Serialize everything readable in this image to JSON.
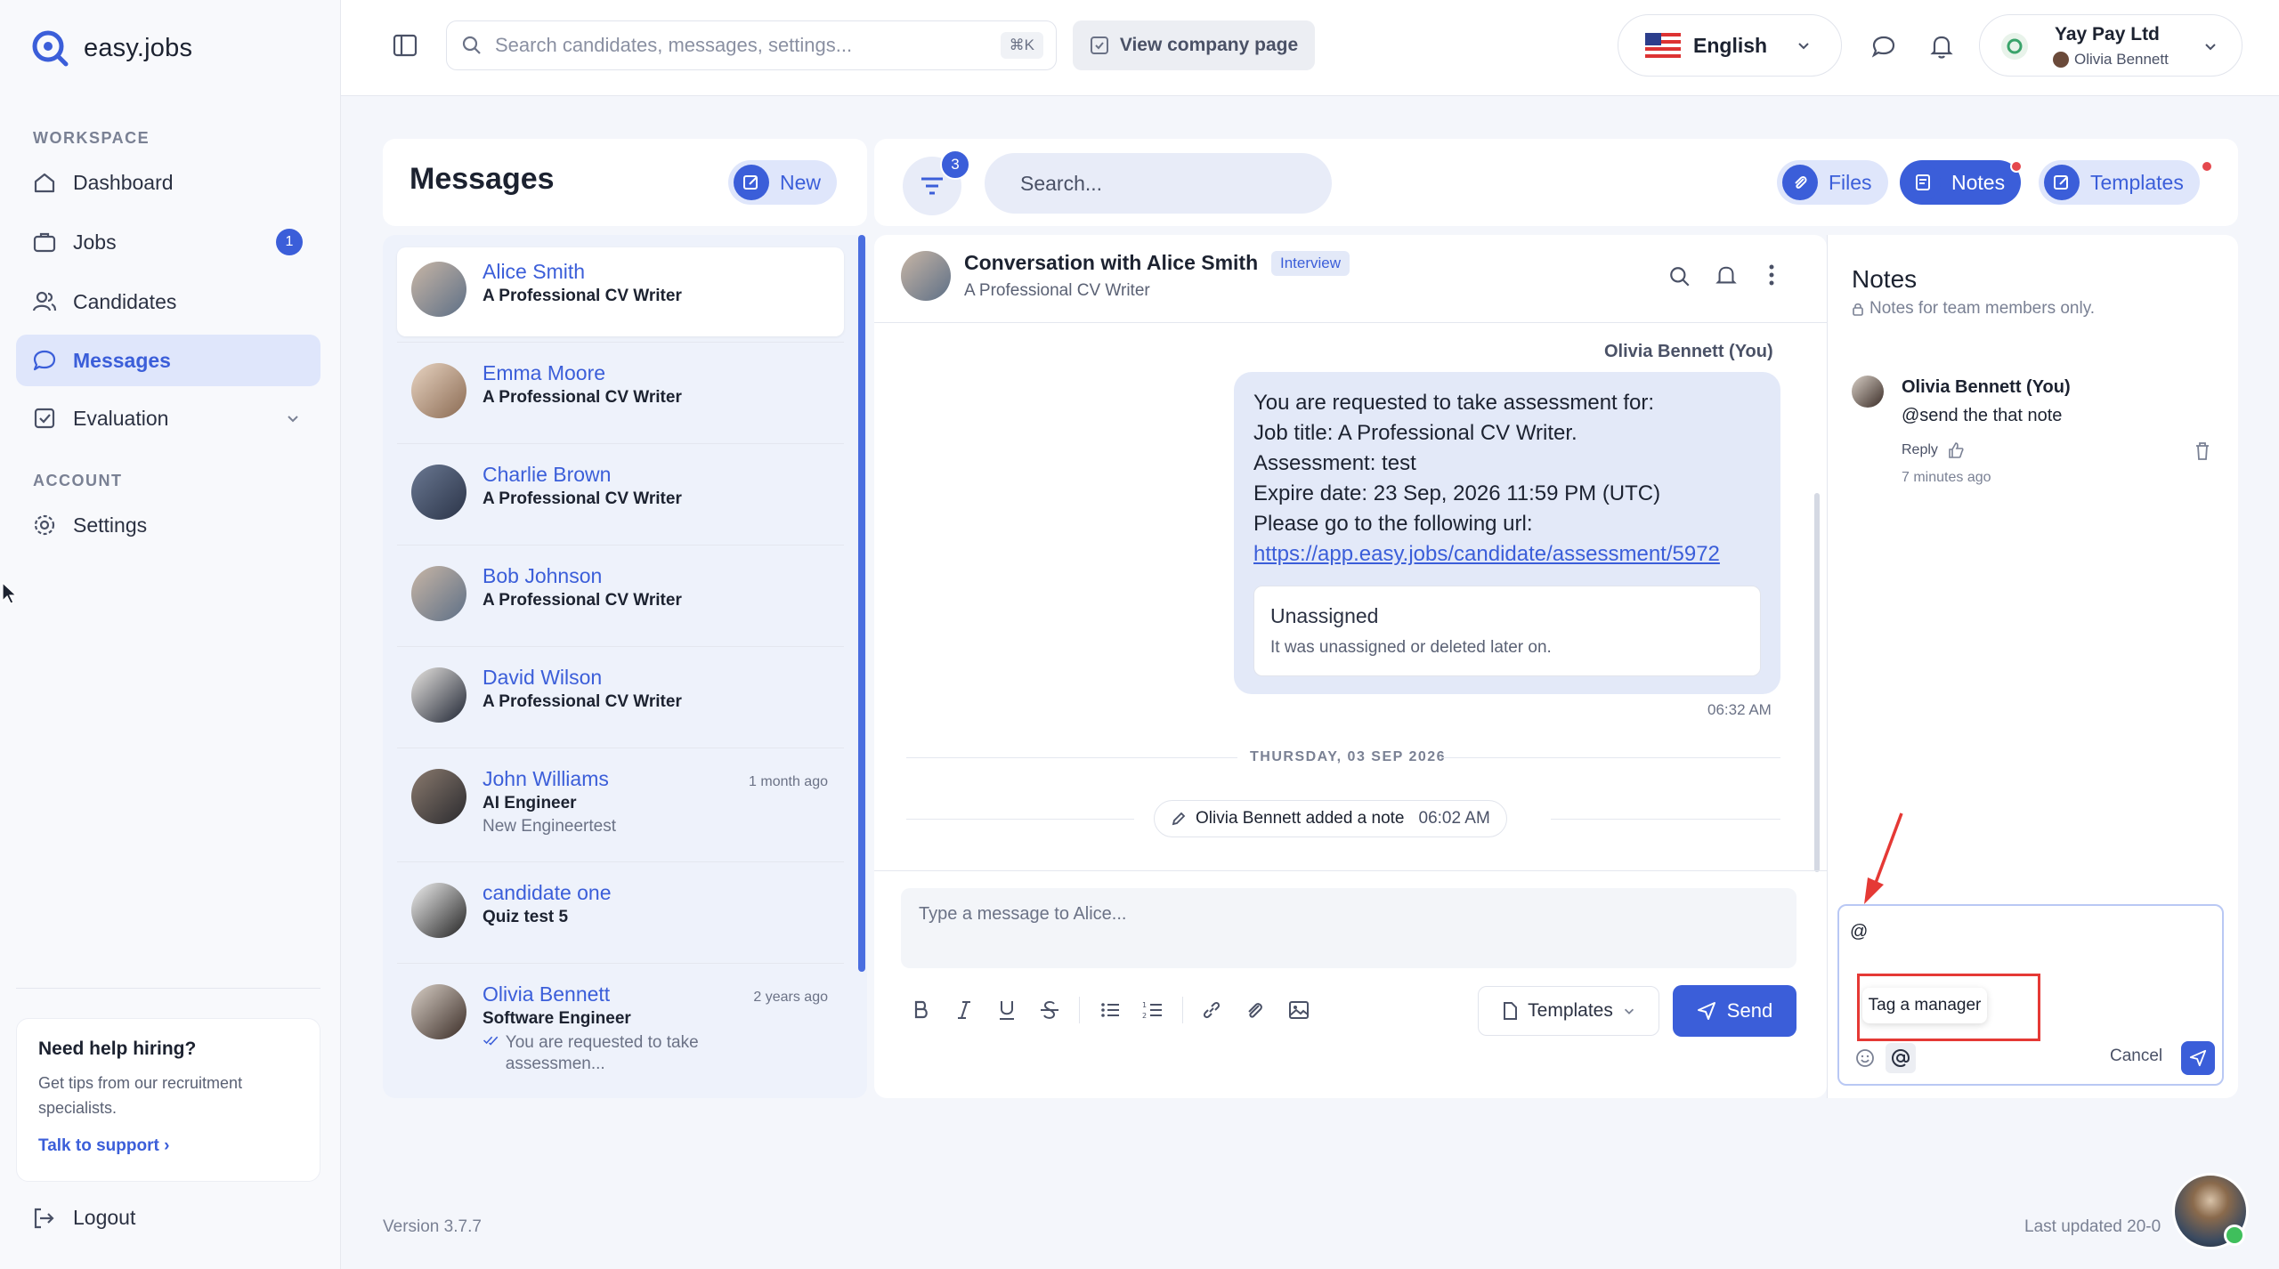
{
  "app": {
    "name": "easy.jobs",
    "version": "Version 3.7.7",
    "last_updated": "Last updated 20-0"
  },
  "sidebar": {
    "workspace_label": "WORKSPACE",
    "account_label": "ACCOUNT",
    "items": [
      {
        "label": "Dashboard",
        "icon": "home-icon"
      },
      {
        "label": "Jobs",
        "icon": "briefcase-icon",
        "badge": "1"
      },
      {
        "label": "Candidates",
        "icon": "users-icon"
      },
      {
        "label": "Messages",
        "icon": "chat-icon",
        "active": true
      },
      {
        "label": "Evaluation",
        "icon": "checkbox-icon"
      }
    ],
    "settings_label": "Settings",
    "help": {
      "title": "Need help hiring?",
      "text": "Get tips from our recruitment specialists.",
      "link": "Talk to support"
    },
    "logout_label": "Logout"
  },
  "topbar": {
    "search_placeholder": "Search candidates, messages, settings...",
    "shortcut": "⌘K",
    "view_company": "View company page",
    "language": "English",
    "company": "Yay Pay Ltd",
    "user": "Olivia Bennett"
  },
  "messages": {
    "title": "Messages",
    "new_label": "New",
    "filter_count": "3",
    "search_placeholder": "Search...",
    "files_label": "Files",
    "notes_label": "Notes",
    "templates_label": "Templates",
    "conversations": [
      {
        "name": "Alice Smith",
        "role": "A Professional CV Writer",
        "sub": "",
        "time": ""
      },
      {
        "name": "Emma Moore",
        "role": "A Professional CV Writer",
        "sub": "",
        "time": ""
      },
      {
        "name": "Charlie Brown",
        "role": "A Professional CV Writer",
        "sub": "",
        "time": ""
      },
      {
        "name": "Bob Johnson",
        "role": "A Professional CV Writer",
        "sub": "",
        "time": ""
      },
      {
        "name": "David Wilson",
        "role": "A Professional CV Writer",
        "sub": "",
        "time": ""
      },
      {
        "name": "John Williams",
        "role": "AI Engineer",
        "sub": "New Engineertest",
        "time": "1 month ago"
      },
      {
        "name": "candidate one",
        "role": "Quiz test 5",
        "sub": "",
        "time": ""
      },
      {
        "name": "Olivia Bennett",
        "role": "Software Engineer",
        "sub": "You are requested to take assessmen...",
        "time": "2 years ago"
      }
    ]
  },
  "chat": {
    "title": "Conversation with Alice Smith",
    "tag": "Interview",
    "subtitle": "A Professional CV Writer",
    "sender": "Olivia Bennett (You)",
    "lines": [
      "You are requested to take assessment for:",
      "Job title: A Professional CV Writer.",
      "Assessment: test",
      "Expire date: 23 Sep, 2026 11:59 PM (UTC)",
      "Please go to the following url:"
    ],
    "url": "https://app.easy.jobs/candidate/assessment/5972",
    "card_title": "Unassigned",
    "card_desc": "It was unassigned or deleted later on.",
    "msg_time": "06:32 AM",
    "date_sep": "THURSDAY, 03 SEP 2026",
    "event_text": "Olivia Bennett added a note",
    "event_time": "06:02 AM",
    "input_placeholder": "Type a message to Alice...",
    "templates_label": "Templates",
    "send_label": "Send"
  },
  "notes": {
    "title": "Notes",
    "subtitle": "Notes for team members only.",
    "author": "Olivia Bennett (You)",
    "text": "@send the that note",
    "reply_label": "Reply",
    "time": "7 minutes ago",
    "input_value": "@",
    "tooltip": "Tag a manager",
    "cancel_label": "Cancel"
  },
  "colors": {
    "accent": "#3b5ed9",
    "highlight": "#e53935"
  }
}
